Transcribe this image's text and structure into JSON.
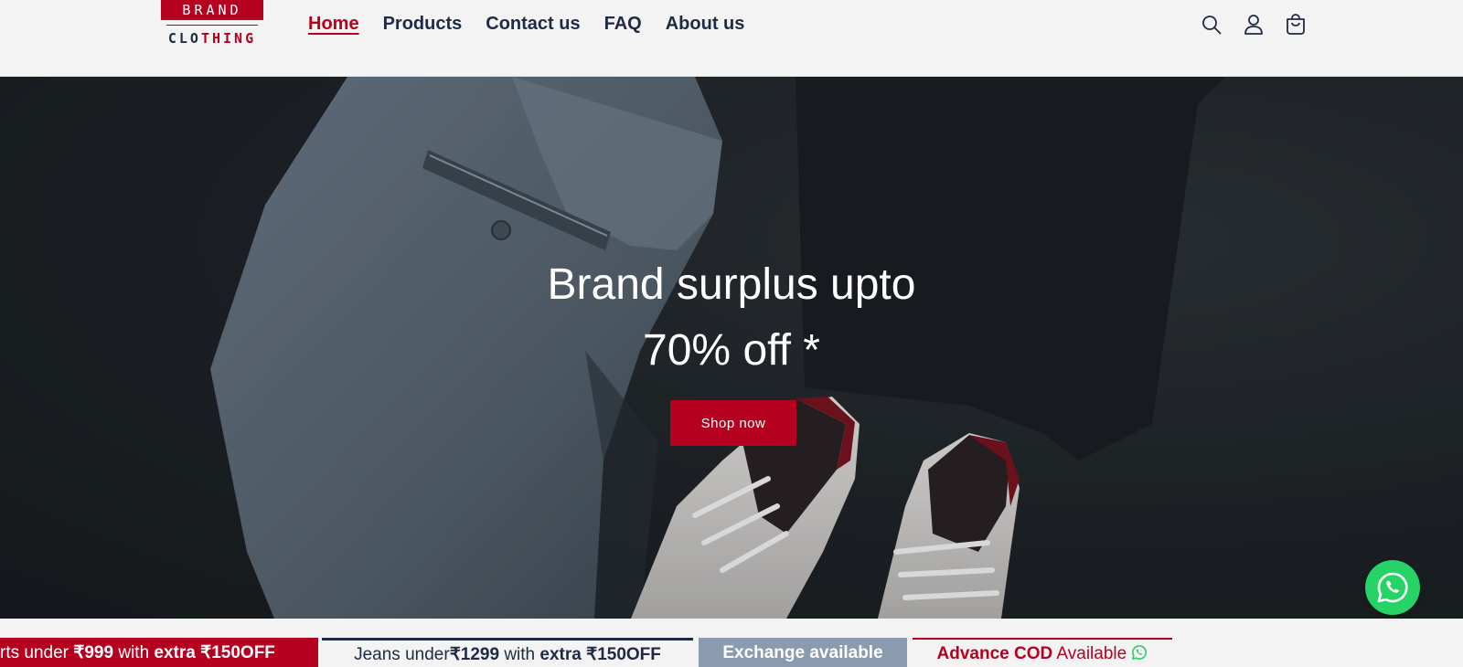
{
  "logo": {
    "top": "BRAND",
    "bottom_dark": "CLO",
    "bottom_red": "THING"
  },
  "nav": {
    "items": [
      {
        "label": "Home",
        "active": true
      },
      {
        "label": "Products"
      },
      {
        "label": "Contact us"
      },
      {
        "label": "FAQ"
      },
      {
        "label": "About us"
      }
    ]
  },
  "header_icons": [
    "search-icon",
    "account-icon",
    "cart-icon"
  ],
  "hero": {
    "title_line1": "Brand surplus upto",
    "title_line2": "70% off *",
    "cta_label": "Shop now"
  },
  "promos": {
    "p1": {
      "a": "rts under ",
      "b": "₹999",
      "c": " with ",
      "d": "extra ₹150OFF"
    },
    "p2": {
      "a": "Jeans under",
      "b": "₹1299",
      "c": " with ",
      "d": "extra ₹150OFF"
    },
    "p3": {
      "a": "Exchange available"
    },
    "p4": {
      "a": "Advance COD",
      "b": " Available"
    }
  },
  "colors": {
    "brand_red": "#b5001f",
    "navy": "#1f2a44",
    "whatsapp": "#25d366"
  }
}
